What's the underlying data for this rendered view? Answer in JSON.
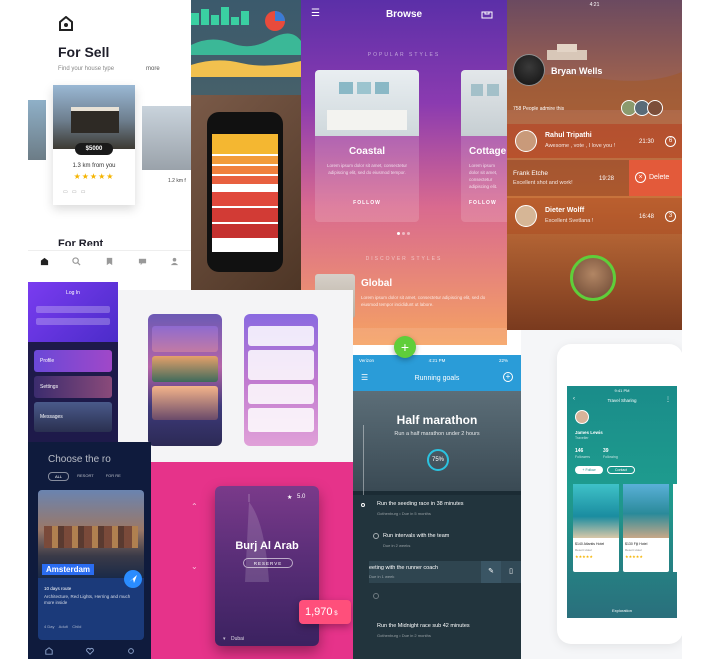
{
  "colors": {
    "accent_green": "#5fce3a",
    "chat_red": "#e35a3a",
    "price_pink": "#ff4f7b",
    "blue": "#2a8cff",
    "teal": "#1bb5a4"
  },
  "for_sell": {
    "title": "For Sell",
    "subtitle": "Find your house type",
    "more": "more",
    "price_tag": "$5000",
    "distance": "1.3 km from you",
    "stars": "★★★★★",
    "side_text": "1.2 km f",
    "section_next": "For Rent",
    "icons": [
      "home-icon",
      "search-icon",
      "bookmark-icon",
      "chat-icon",
      "user-icon"
    ]
  },
  "browse": {
    "title": "Browse",
    "popular_label": "POPULAR STYLES",
    "card1_title": "Coastal",
    "card1_desc": "Lorem ipsum dolor sit amet, consectetur adipiscing elit, sed do eiusmod tempor.",
    "card1_button": "FOLLOW",
    "card2_title": "Cottage",
    "card2_desc": "Lorem ipsum dolor sit amet, consectetur adipiscing elit.",
    "card2_button": "FOLLOW",
    "discover_label": "DISCOVER STYLES",
    "global_title": "Global",
    "global_desc": "Lorem ipsum dolor sit amet, consectetur adipiscing elit, sed do eiusmod tempor incididunt ut labore."
  },
  "chat": {
    "time": "4:21",
    "profile_name": "Bryan Wells",
    "admire_text": "758 People admire this",
    "messages": [
      {
        "name": "Rahul Tripathi",
        "text": "Awesome , vote , I love you !",
        "time": "21:30",
        "count": "6"
      },
      {
        "name": "Frank Etche",
        "text": "Excellent shot and work!",
        "time": "19:28",
        "count": ""
      },
      {
        "name": "Dieter Wolff",
        "text": "Excellent Svetlana !",
        "time": "16:48",
        "count": "3"
      }
    ],
    "delete_label": "Delete"
  },
  "purple_mini": {
    "title": "Log In",
    "rows": [
      "Profile",
      "Settings",
      "Messages"
    ]
  },
  "amsterdam": {
    "heading": "Choose the ro",
    "tabs": [
      "ALL",
      "RESORT",
      "FOR RE"
    ],
    "city": "Amsterdam",
    "tagline": "10 days route",
    "desc": "Architecture, Red Lights, Herring and much more inside",
    "meta": "4 Day    Adult    Child"
  },
  "burj": {
    "rating": "5.0",
    "title": "Burj Al Arab",
    "reserve": "RESERVE",
    "location": "Dubai",
    "price": "1,970"
  },
  "running": {
    "status_left": "Verizon",
    "status_time": "4:21 PM",
    "status_right": "22%",
    "title": "Running goals",
    "goal_title": "Half marathon",
    "goal_sub": "Run a half marathon under 2 hours",
    "percent": "75",
    "tasks": [
      {
        "title": "Run the seeding race in 38 minutes",
        "sub": "Gothenburg • Due in 5 months"
      },
      {
        "title": "Run intervals with the team",
        "sub": "Due in 2 weeks"
      },
      {
        "title": "eeting with the runner coach",
        "sub": "Due in 1 week"
      },
      {
        "title": "Run the Midnight race sub 42 minutes",
        "sub": "Gothenburg • Due in 2 months"
      }
    ]
  },
  "travel": {
    "status_time": "9:41 PM",
    "title": "Travel Sharing",
    "user_name": "James Lewis",
    "user_role": "Traveller",
    "stat1_value": "146",
    "stat1_label": "Followers",
    "stat2_value": "39",
    "stat2_label": "Following",
    "follow_btn": "+ Follow",
    "contact_btn": "Contact",
    "card1_price": "$140 Atlantis Hotel",
    "card1_sub": "Resort Hotel",
    "card2_price": "$130 Fiji Hotel",
    "card2_sub": "Resort Hotel",
    "bottom_tab": "Exploration"
  }
}
